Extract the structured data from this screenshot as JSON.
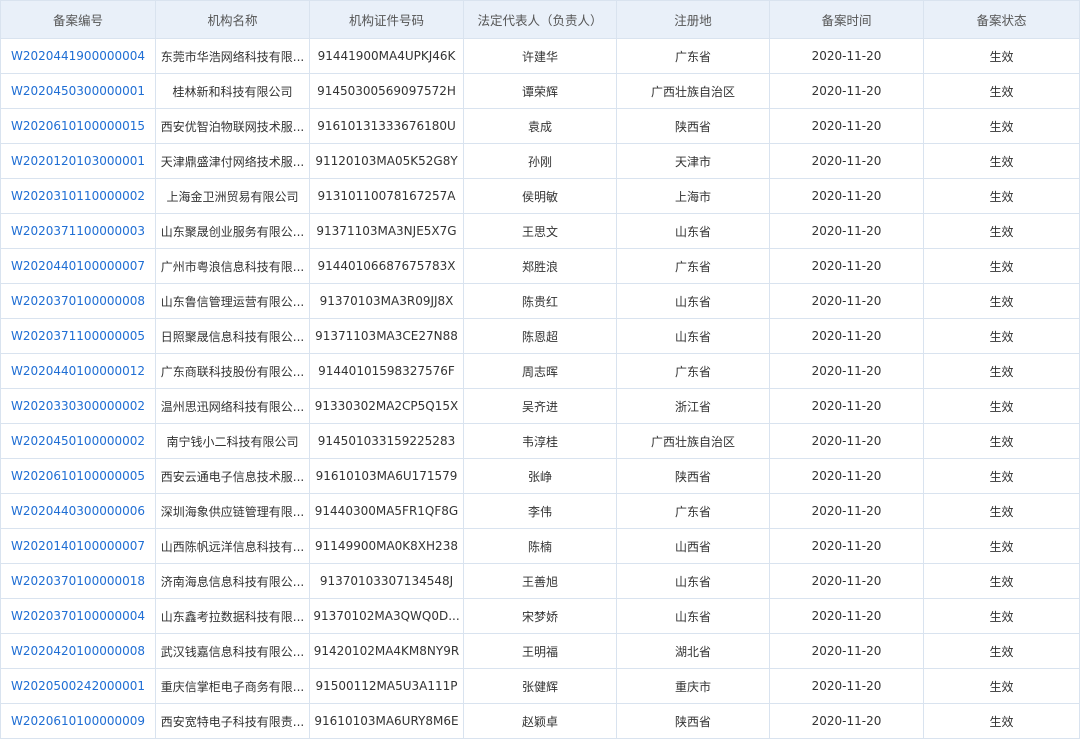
{
  "table": {
    "headers": [
      "备案编号",
      "机构名称",
      "机构证件号码",
      "法定代表人（负责人）",
      "注册地",
      "备案时间",
      "备案状态"
    ],
    "rows": [
      [
        "W2020441900000004",
        "东莞市华浩网络科技有限...",
        "91441900MA4UPKJ46K",
        "许建华",
        "广东省",
        "2020-11-20",
        "生效"
      ],
      [
        "W2020450300000001",
        "桂林新和科技有限公司",
        "91450300569097572H",
        "谭荣辉",
        "广西壮族自治区",
        "2020-11-20",
        "生效"
      ],
      [
        "W2020610100000015",
        "西安优智泊物联网技术服...",
        "91610131333676180U",
        "袁成",
        "陕西省",
        "2020-11-20",
        "生效"
      ],
      [
        "W2020120103000001",
        "天津鼎盛津付网络技术服...",
        "91120103MA05K52G8Y",
        "孙刚",
        "天津市",
        "2020-11-20",
        "生效"
      ],
      [
        "W2020310110000002",
        "上海金卫洲贸易有限公司",
        "91310110078167257A",
        "侯明敏",
        "上海市",
        "2020-11-20",
        "生效"
      ],
      [
        "W2020371100000003",
        "山东聚晟创业服务有限公...",
        "91371103MA3NJE5X7G",
        "王思文",
        "山东省",
        "2020-11-20",
        "生效"
      ],
      [
        "W2020440100000007",
        "广州市粤浪信息科技有限...",
        "91440106687675783X",
        "郑胜浪",
        "广东省",
        "2020-11-20",
        "生效"
      ],
      [
        "W2020370100000008",
        "山东鲁信管理运营有限公...",
        "91370103MA3R09JJ8X",
        "陈贵红",
        "山东省",
        "2020-11-20",
        "生效"
      ],
      [
        "W2020371100000005",
        "日照聚晟信息科技有限公...",
        "91371103MA3CE27N88",
        "陈恩超",
        "山东省",
        "2020-11-20",
        "生效"
      ],
      [
        "W2020440100000012",
        "广东商联科技股份有限公...",
        "91440101598327576F",
        "周志晖",
        "广东省",
        "2020-11-20",
        "生效"
      ],
      [
        "W2020330300000002",
        "温州思迅网络科技有限公...",
        "91330302MA2CP5Q15X",
        "吴齐进",
        "浙江省",
        "2020-11-20",
        "生效"
      ],
      [
        "W2020450100000002",
        "南宁钱小二科技有限公司",
        "914501033159225283",
        "韦淳桂",
        "广西壮族自治区",
        "2020-11-20",
        "生效"
      ],
      [
        "W2020610100000005",
        "西安云通电子信息技术服...",
        "91610103MA6U171579",
        "张峥",
        "陕西省",
        "2020-11-20",
        "生效"
      ],
      [
        "W2020440300000006",
        "深圳海象供应链管理有限...",
        "91440300MA5FR1QF8G",
        "李伟",
        "广东省",
        "2020-11-20",
        "生效"
      ],
      [
        "W2020140100000007",
        "山西陈帆远洋信息科技有...",
        "91149900MA0K8XH238",
        "陈楠",
        "山西省",
        "2020-11-20",
        "生效"
      ],
      [
        "W2020370100000018",
        "济南海息信息科技有限公...",
        "91370103307134548J",
        "王善旭",
        "山东省",
        "2020-11-20",
        "生效"
      ],
      [
        "W2020370100000004",
        "山东鑫考拉数据科技有限...",
        "91370102MA3QWQ0D...",
        "宋梦娇",
        "山东省",
        "2020-11-20",
        "生效"
      ],
      [
        "W2020420100000008",
        "武汉钱嘉信息科技有限公...",
        "91420102MA4KM8NY9R",
        "王明福",
        "湖北省",
        "2020-11-20",
        "生效"
      ],
      [
        "W2020500242000001",
        "重庆信掌柜电子商务有限...",
        "91500112MA5U3A111P",
        "张健辉",
        "重庆市",
        "2020-11-20",
        "生效"
      ],
      [
        "W2020610100000009",
        "西安宽特电子科技有限责...",
        "91610103MA6URY8M6E",
        "赵颖卓",
        "陕西省",
        "2020-11-20",
        "生效"
      ]
    ]
  }
}
